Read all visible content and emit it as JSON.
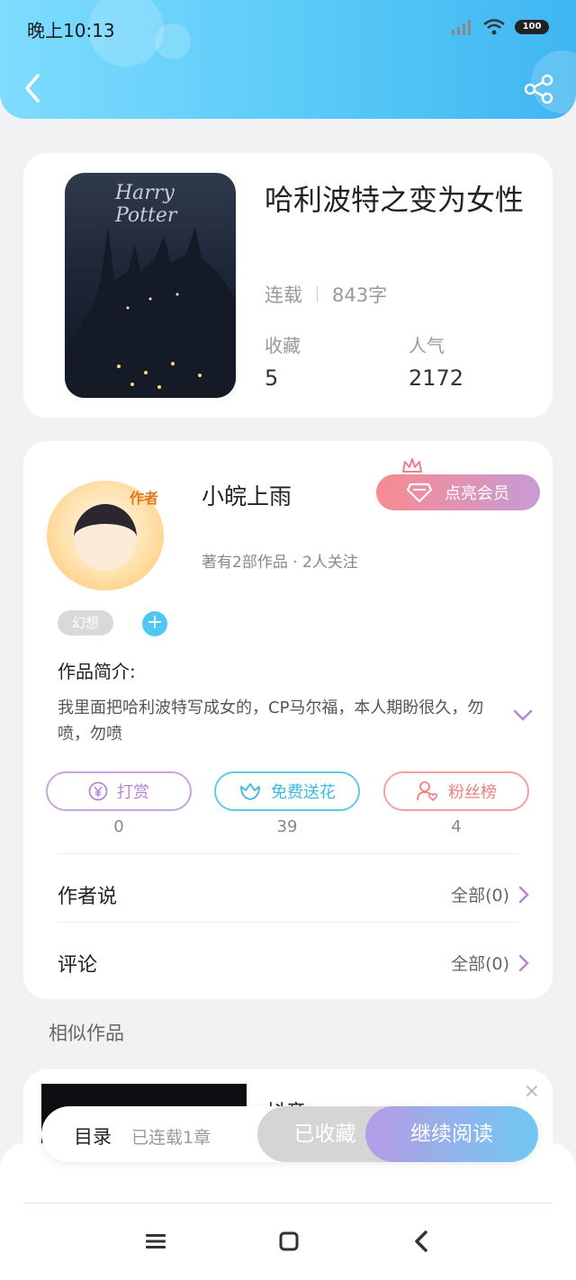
{
  "status_bar": {
    "time": "晚上10:13",
    "battery": "100"
  },
  "book": {
    "title": "哈利波特之变为女性",
    "cover_logo": "Harry Potter",
    "status": "连载",
    "word_count": "843字",
    "stats": [
      {
        "label": "收藏",
        "value": "5"
      },
      {
        "label": "人气",
        "value": "2172"
      }
    ]
  },
  "author": {
    "name": "小皖上雨",
    "avatar_badge": "作者",
    "subtitle": "著有2部作品 · 2人关注",
    "vip_button": "点亮会员",
    "tag": "幻想",
    "tag_add": "+"
  },
  "intro": {
    "title": "作品简介:",
    "text": "我里面把哈利波特写成女的，CP马尔福，本人期盼很久，勿喷，勿喷"
  },
  "actions": [
    {
      "label": "打赏",
      "count": "0"
    },
    {
      "label": "免费送花",
      "count": "39"
    },
    {
      "label": "粉丝榜",
      "count": "4"
    }
  ],
  "rows": [
    {
      "label": "作者说",
      "right": "全部(0)"
    },
    {
      "label": "评论",
      "right": "全部(0)"
    }
  ],
  "similar": {
    "title": "相似作品",
    "item_name": "抖音",
    "close": "×"
  },
  "bottom_bar": {
    "toc_label": "目录",
    "toc_sub": "已连载1章",
    "collect": "已收藏",
    "read": "继续阅读"
  },
  "colors": {
    "header": "#56c8f7",
    "vip": "#f98a8f",
    "reward": "#b487d6",
    "flower": "#3cb9e0",
    "fans": "#f07f7f"
  },
  "icons": [
    "back-icon",
    "share-icon",
    "crown-icon",
    "diamond-icon",
    "yen-icon",
    "flower-icon",
    "fans-icon",
    "chevron-down-icon",
    "chevron-right-icon",
    "close-icon",
    "menu-icon",
    "home-icon",
    "nav-back-icon"
  ]
}
